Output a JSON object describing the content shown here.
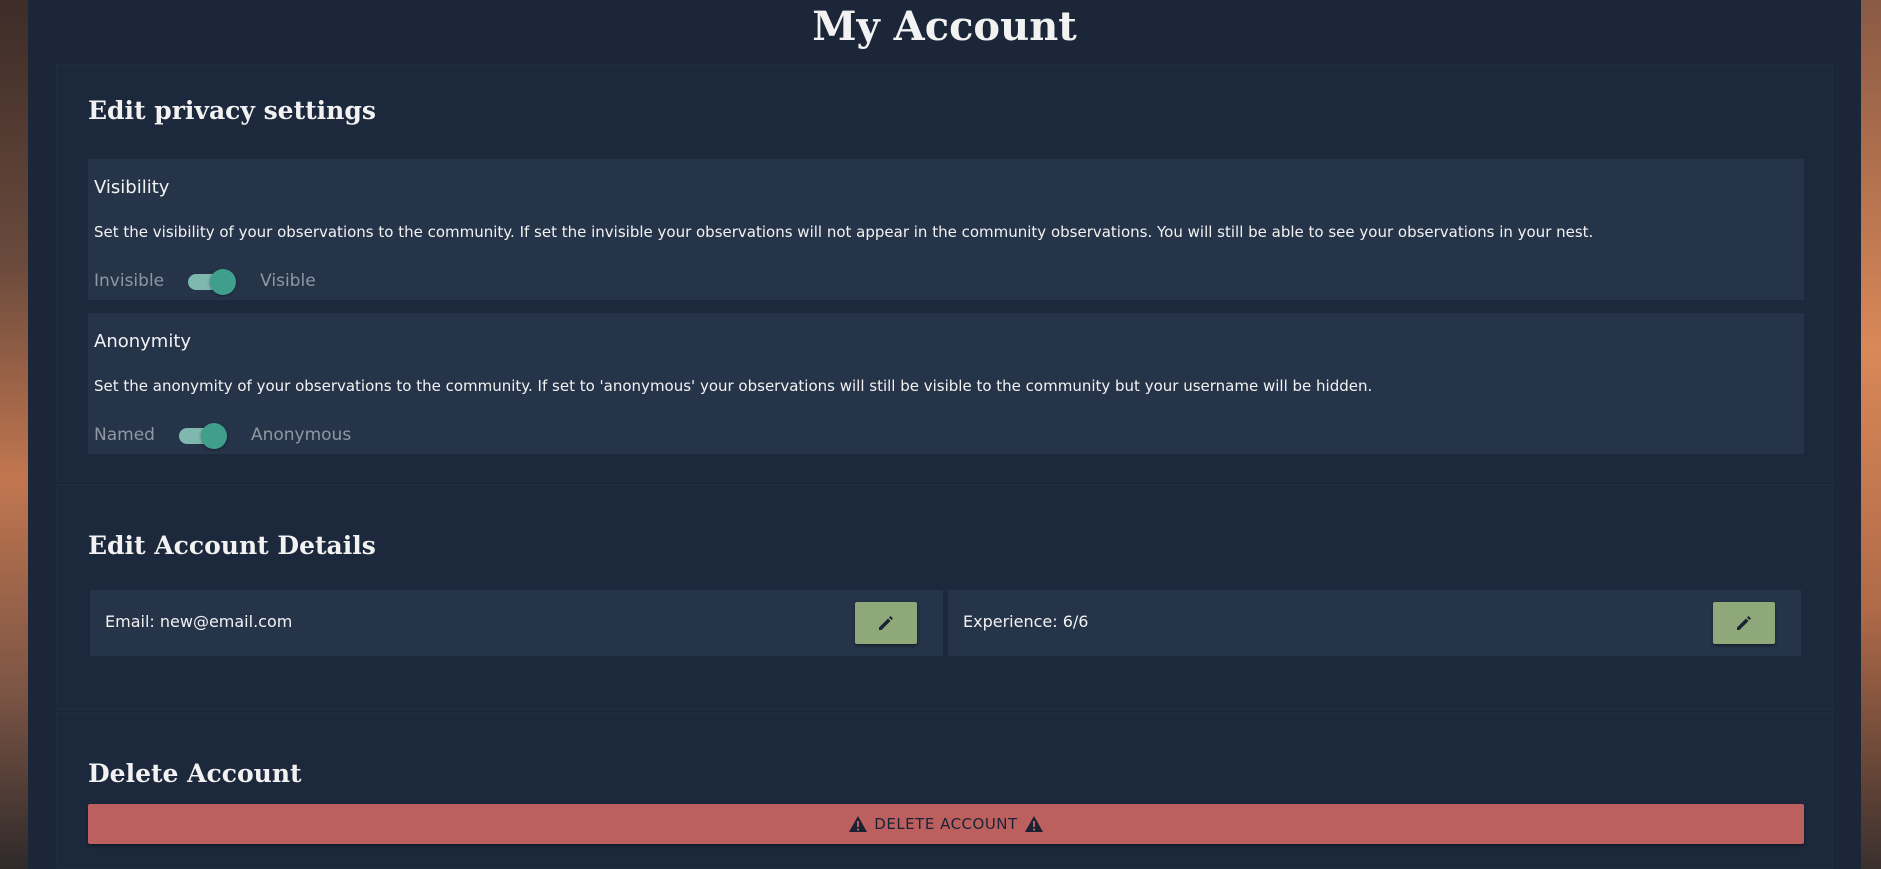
{
  "page": {
    "title": "My Account"
  },
  "privacy": {
    "title": "Edit privacy settings",
    "visibility": {
      "heading": "Visibility",
      "description": "Set the visibility of your observations to the community. If set the invisible your observations will not appear in the community observations. You will still be able to see your observations in your nest.",
      "off_label": "Invisible",
      "on_label": "Visible",
      "enabled": true
    },
    "anonymity": {
      "heading": "Anonymity",
      "description": "Set the anonymity of your observations to the community. If set to 'anonymous' your observations will still be visible to the community but your username will be hidden.",
      "off_label": "Named",
      "on_label": "Anonymous",
      "enabled": true
    }
  },
  "details": {
    "title": "Edit Account Details",
    "email_text": "Email: new@email.com",
    "experience_text": "Experience: 6/6",
    "edit_icon": "pencil-icon"
  },
  "delete": {
    "title": "Delete Account",
    "button_label": "DELETE ACCOUNT",
    "icon": "warning-icon"
  },
  "colors": {
    "panel": "#1b2639",
    "box": "#26344a",
    "toggle_accent": "#3f9e8c",
    "edit_button": "#8fa87a",
    "delete_button": "#bb605f"
  }
}
